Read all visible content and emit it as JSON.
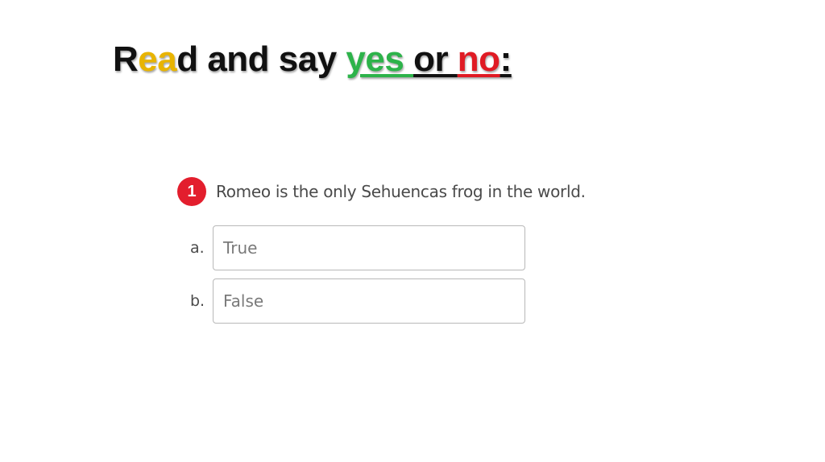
{
  "title": {
    "segments": [
      {
        "text": "R",
        "color": "#111111"
      },
      {
        "text": "ea",
        "color": "#e8b400"
      },
      {
        "text": "d and say ",
        "color": "#111111"
      },
      {
        "text": "yes ",
        "color": "#2db34a"
      },
      {
        "text": "or ",
        "color": "#111111"
      },
      {
        "text": "no",
        "color": "#e01b24"
      },
      {
        "text": ":",
        "color": "#111111"
      }
    ]
  },
  "question": {
    "number": "1",
    "number_badge_color": "#e31e2d",
    "text": "Romeo is the only Sehuencas frog in the world."
  },
  "options": [
    {
      "letter": "a.",
      "label": "True"
    },
    {
      "letter": "b.",
      "label": "False"
    }
  ]
}
